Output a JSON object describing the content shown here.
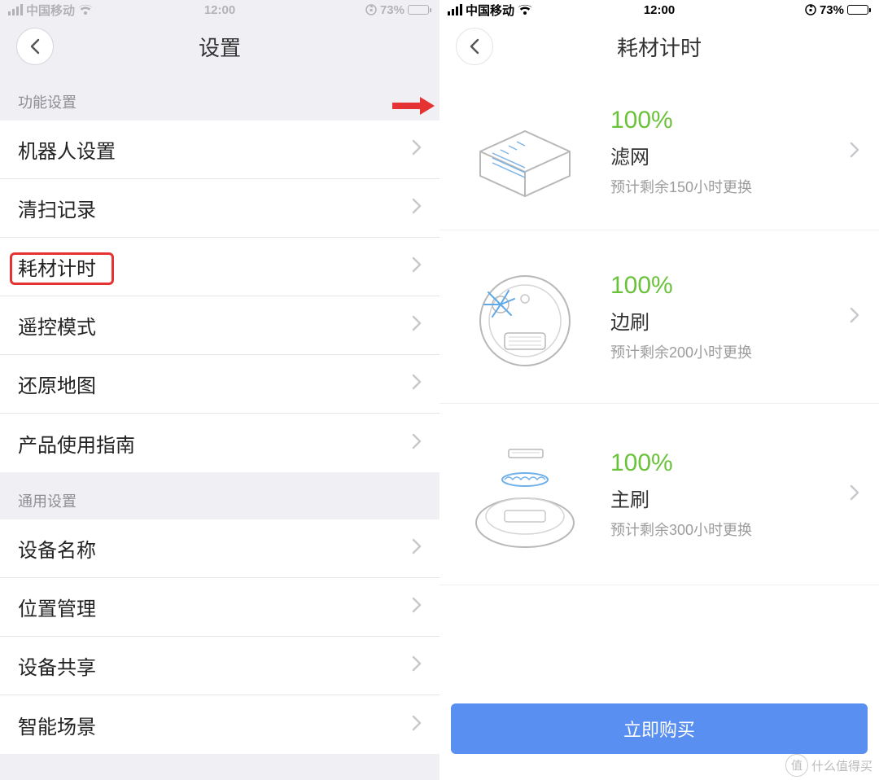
{
  "status": {
    "carrier": "中国移动",
    "time": "12:00",
    "battery_pct": "73%",
    "battery_fill": 73
  },
  "left": {
    "title": "设置",
    "section1": "功能设置",
    "rows1": [
      "机器人设置",
      "清扫记录",
      "耗材计时",
      "遥控模式",
      "还原地图",
      "产品使用指南"
    ],
    "section2": "通用设置",
    "rows2": [
      "设备名称",
      "位置管理",
      "设备共享",
      "智能场景"
    ],
    "highlight_index": 2
  },
  "right": {
    "title": "耗材计时",
    "items": [
      {
        "pct": "100%",
        "name": "滤网",
        "sub": "预计剩余150小时更换"
      },
      {
        "pct": "100%",
        "name": "边刷",
        "sub": "预计剩余200小时更换"
      },
      {
        "pct": "100%",
        "name": "主刷",
        "sub": "预计剩余300小时更换"
      }
    ],
    "buy": "立即购买"
  },
  "watermark": {
    "glyph": "值",
    "text": "什么值得买"
  }
}
